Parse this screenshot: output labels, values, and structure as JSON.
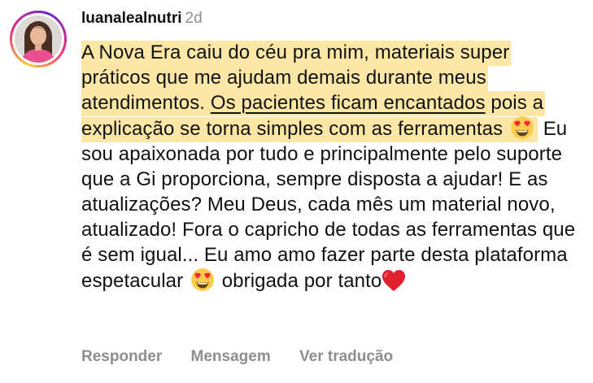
{
  "comment": {
    "username": "luanalealnutri",
    "time": "2d",
    "text": {
      "highlight_1": "A Nova Era caiu do céu pra mim, materiais super práticos que me ajudam demais durante meus atendimentos. ",
      "highlight_underlined": "Os pacientes ficam encantados",
      "highlight_2": " pois a explicação se torna simples com as ferramentas ",
      "rest_1": " Eu sou apaixonada por tudo e principalmente pelo suporte que a Gi proporciona, sempre disposta a ajudar! E as atualizações? Meu Deus, cada mês um material novo, atualizado! Fora o capricho de todas as ferramentas que é sem igual... Eu amo amo fazer parte desta plataforma espetacular ",
      "rest_2": " obrigada por tanto"
    },
    "emojis": [
      "heart-eyes-emoji",
      "heart-eyes-emoji",
      "red-heart-emoji"
    ],
    "highlight_color": "#fce7a6"
  },
  "actions": {
    "reply": "Responder",
    "message": "Mensagem",
    "translate": "Ver tradução"
  },
  "colors": {
    "text": "#111111",
    "muted": "#8e8e8e",
    "ring": [
      "#f9ce34",
      "#ee2a7b",
      "#6228d7"
    ]
  }
}
